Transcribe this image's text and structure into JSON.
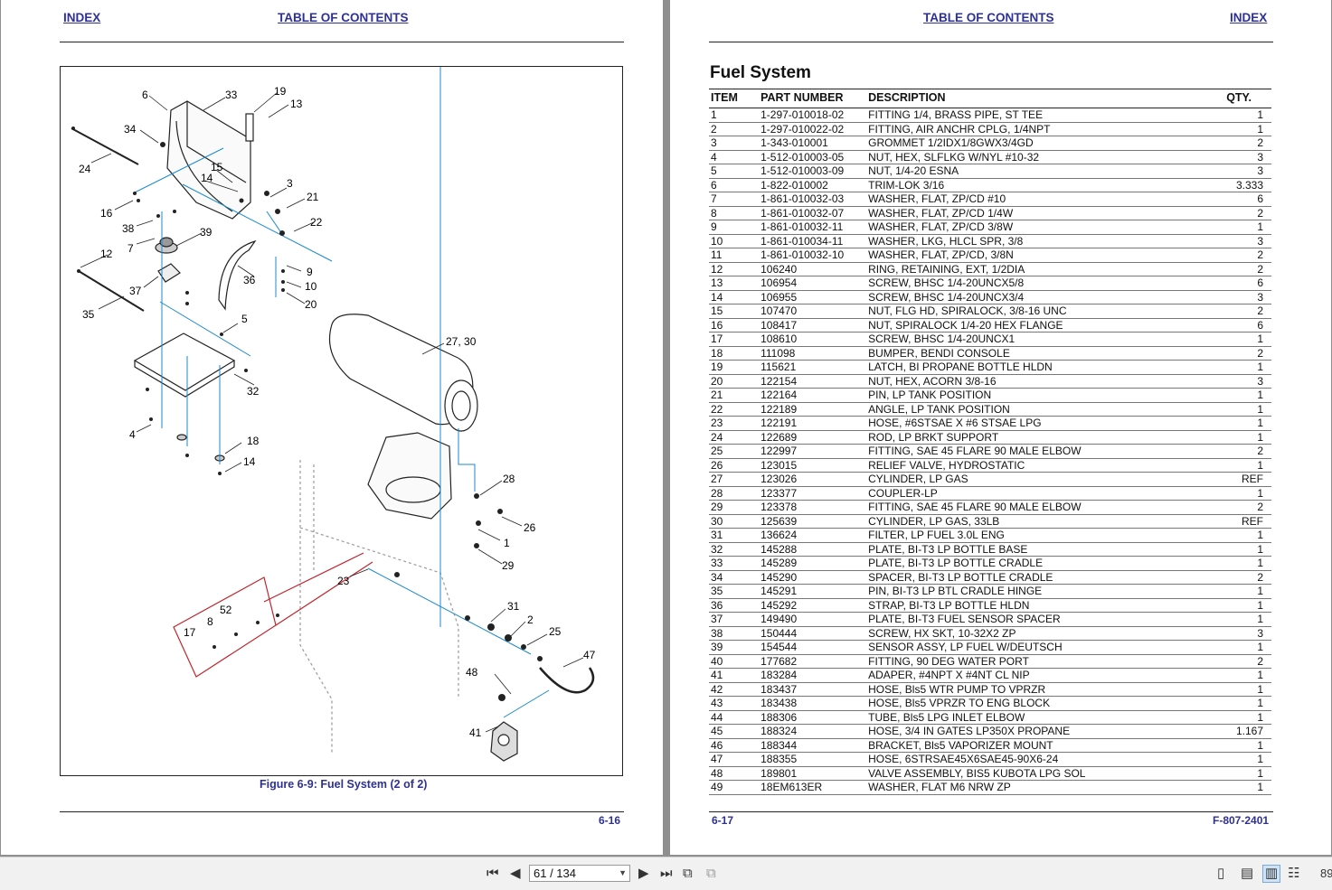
{
  "left_page": {
    "index_link": "INDEX",
    "toc_link": "TABLE OF CONTENTS",
    "figure_caption": "Figure 6-9:  Fuel System (2 of 2)",
    "page_number": "6-16",
    "callouts": [
      "6",
      "33",
      "19",
      "13",
      "34",
      "24",
      "15",
      "14",
      "3",
      "21",
      "16",
      "38",
      "7",
      "39",
      "22",
      "12",
      "9",
      "37",
      "36",
      "10",
      "35",
      "20",
      "5",
      "27, 30",
      "32",
      "4",
      "18",
      "14",
      "28",
      "26",
      "1",
      "29",
      "23",
      "31",
      "2",
      "25",
      "52",
      "8",
      "17",
      "47",
      "48",
      "41"
    ]
  },
  "right_page": {
    "toc_link": "TABLE OF CONTENTS",
    "index_link": "INDEX",
    "section_title": "Fuel System",
    "columns": [
      "ITEM",
      "PART NUMBER",
      "DESCRIPTION",
      "QTY."
    ],
    "rows": [
      [
        "1",
        "1-297-010018-02",
        "FITTING 1/4, BRASS PIPE, ST TEE",
        "1"
      ],
      [
        "2",
        "1-297-010022-02",
        "FITTING, AIR ANCHR CPLG, 1/4NPT",
        "1"
      ],
      [
        "3",
        "1-343-010001",
        "GROMMET 1/2IDX1/8GWX3/4GD",
        "2"
      ],
      [
        "4",
        "1-512-010003-05",
        "NUT, HEX, SLFLKG W/NYL #10-32",
        "3"
      ],
      [
        "5",
        "1-512-010003-09",
        "NUT, 1/4-20 ESNA",
        "3"
      ],
      [
        "6",
        "1-822-010002",
        "TRIM-LOK 3/16",
        "3.333"
      ],
      [
        "7",
        "1-861-010032-03",
        "WASHER, FLAT, ZP/CD #10",
        "6"
      ],
      [
        "8",
        "1-861-010032-07",
        "WASHER, FLAT, ZP/CD 1/4W",
        "2"
      ],
      [
        "9",
        "1-861-010032-11",
        "WASHER, FLAT, ZP/CD 3/8W",
        "1"
      ],
      [
        "10",
        "1-861-010034-11",
        "WASHER, LKG, HLCL SPR, 3/8",
        "3"
      ],
      [
        "11",
        "1-861-010032-10",
        "WASHER, FLAT, ZP/CD, 3/8N",
        "2"
      ],
      [
        "12",
        "106240",
        "RING, RETAINING, EXT, 1/2DIA",
        "2"
      ],
      [
        "13",
        "106954",
        "SCREW, BHSC 1/4-20UNCX5/8",
        "6"
      ],
      [
        "14",
        "106955",
        "SCREW, BHSC 1/4-20UNCX3/4",
        "3"
      ],
      [
        "15",
        "107470",
        "NUT, FLG HD, SPIRALOCK, 3/8-16 UNC",
        "2"
      ],
      [
        "16",
        "108417",
        "NUT, SPIRALOCK 1/4-20 HEX FLANGE",
        "6"
      ],
      [
        "17",
        "108610",
        "SCREW, BHSC 1/4-20UNCX1",
        "1"
      ],
      [
        "18",
        "111098",
        "BUMPER, BENDI CONSOLE",
        "2"
      ],
      [
        "19",
        "115621",
        "LATCH, BI PROPANE BOTTLE HLDN",
        "1"
      ],
      [
        "20",
        "122154",
        "NUT, HEX, ACORN 3/8-16",
        "3"
      ],
      [
        "21",
        "122164",
        "PIN, LP TANK POSITION",
        "1"
      ],
      [
        "22",
        "122189",
        "ANGLE, LP TANK POSITION",
        "1"
      ],
      [
        "23",
        "122191",
        "HOSE, #6STSAE X #6 STSAE LPG",
        "1"
      ],
      [
        "24",
        "122689",
        "ROD, LP BRKT SUPPORT",
        "1"
      ],
      [
        "25",
        "122997",
        "FITTING, SAE 45 FLARE 90 MALE ELBOW",
        "2"
      ],
      [
        "26",
        "123015",
        "RELIEF VALVE, HYDROSTATIC",
        "1"
      ],
      [
        "27",
        "123026",
        "CYLINDER, LP GAS",
        "REF"
      ],
      [
        "28",
        "123377",
        "COUPLER-LP",
        "1"
      ],
      [
        "29",
        "123378",
        "FITTING, SAE 45 FLARE 90 MALE ELBOW",
        "2"
      ],
      [
        "30",
        "125639",
        "CYLINDER, LP GAS, 33LB",
        "REF"
      ],
      [
        "31",
        "136624",
        "FILTER, LP FUEL 3.0L ENG",
        "1"
      ],
      [
        "32",
        "145288",
        "PLATE, BI-T3 LP BOTTLE BASE",
        "1"
      ],
      [
        "33",
        "145289",
        "PLATE, BI-T3 LP BOTTLE CRADLE",
        "1"
      ],
      [
        "34",
        "145290",
        "SPACER, BI-T3 LP BOTTLE CRADLE",
        "2"
      ],
      [
        "35",
        "145291",
        "PIN, BI-T3 LP BTL CRADLE HINGE",
        "1"
      ],
      [
        "36",
        "145292",
        "STRAP, BI-T3 LP BOTTLE HLDN",
        "1"
      ],
      [
        "37",
        "149490",
        "PLATE, BI-T3 FUEL SENSOR SPACER",
        "1"
      ],
      [
        "38",
        "150444",
        "SCREW, HX SKT, 10-32X2 ZP",
        "3"
      ],
      [
        "39",
        "154544",
        "SENSOR ASSY, LP FUEL W/DEUTSCH",
        "1"
      ],
      [
        "40",
        "177682",
        "FITTING, 90 DEG WATER PORT",
        "2"
      ],
      [
        "41",
        "183284",
        "ADAPER, #4NPT X #4NT CL NIP",
        "1"
      ],
      [
        "42",
        "183437",
        "HOSE, Bls5 WTR PUMP TO VPRZR",
        "1"
      ],
      [
        "43",
        "183438",
        "HOSE, Bls5 VPRZR TO ENG BLOCK",
        "1"
      ],
      [
        "44",
        "188306",
        "TUBE, Bls5 LPG INLET ELBOW",
        "1"
      ],
      [
        "45",
        "188324",
        "HOSE, 3/4 IN GATES LP350X PROPANE",
        "1.167"
      ],
      [
        "46",
        "188344",
        "BRACKET, Bls5 VAPORIZER MOUNT",
        "1"
      ],
      [
        "47",
        "188355",
        "HOSE, 6STRSAE45X6SAE45-90X6-24",
        "1"
      ],
      [
        "48",
        "189801",
        "VALVE ASSEMBLY, BIS5 KUBOTA LPG SOL",
        "1"
      ],
      [
        "49",
        "18EM613ER",
        "WASHER, FLAT M6 NRW ZP",
        "1"
      ]
    ],
    "page_number": "6-17",
    "doc_number": "F-807-2401"
  },
  "toolbar": {
    "page_indicator": "61 / 134",
    "zoom_partial": "89"
  }
}
